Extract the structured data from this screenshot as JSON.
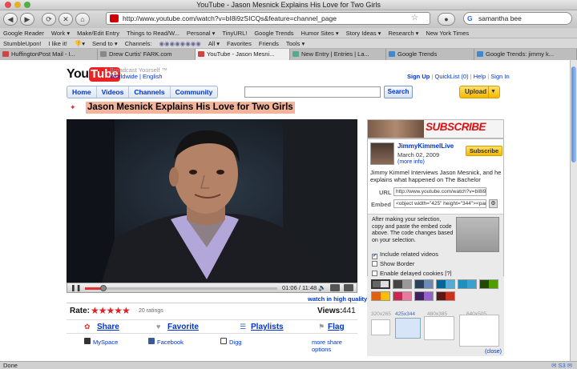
{
  "window": {
    "title": "YouTube - Jason Mesnick Explains His Love for Two Girls"
  },
  "toolbar": {
    "url": "http://www.youtube.com/watch?v=bI8i9zSICQs&feature=channel_page",
    "search_value": "samantha bee"
  },
  "bookmarks_bar1": {
    "items": [
      "Google Reader",
      "Work ▾",
      "Make/Edit Entry",
      "Things to Read/W...",
      "Personal ▾",
      "TinyURL!",
      "Google Trends",
      "Humor Sites ▾",
      "Story Ideas ▾",
      "Research ▾",
      "New York Times"
    ]
  },
  "bookmarks_bar2": {
    "items": [
      "StumbleUpon!",
      "I like it!",
      "Send to ▾",
      "Channels:",
      "All ▾",
      "Favorites",
      "Friends",
      "Tools ▾"
    ]
  },
  "tabs": [
    {
      "label": "HuffingtonPost Mail - I..."
    },
    {
      "label": "Drew Curtis' FARK.com"
    },
    {
      "label": "YouTube - Jason Mesni..."
    },
    {
      "label": "New Entry | Entries | La..."
    },
    {
      "label": "Google Trends"
    },
    {
      "label": "Google Trends: jimmy k..."
    }
  ],
  "header": {
    "logo_you": "You",
    "logo_tube": "Tube",
    "slogan": "Broadcast Yourself ™",
    "worldwide": "Worldwide | English",
    "sign_up": "Sign Up",
    "quicklist": "QuickList (0)",
    "help": "Help",
    "sign_in": "Sign In",
    "nav": [
      "Home",
      "Videos",
      "Channels",
      "Community"
    ],
    "search_button": "Search",
    "upload_button": "Upload"
  },
  "video": {
    "title": "Jason Mesnick Explains His Love for Two Girls",
    "time": "01:06 / 11:48",
    "high_quality": "watch in high quality",
    "progress_fraction": 0.094
  },
  "rating": {
    "label": "Rate:",
    "stars": "★★★★★",
    "count": "20 ratings",
    "views_label": "Views:",
    "views": "441"
  },
  "actions": {
    "share": "Share",
    "favorite": "Favorite",
    "playlists": "Playlists",
    "flag": "Flag"
  },
  "share_links": {
    "myspace": "MySpace",
    "facebook": "Facebook",
    "digg": "Digg",
    "more": "more share options"
  },
  "sidebar": {
    "subscribe_banner": "SUBSCRIBE",
    "channel_name": "JimmyKimmelLive",
    "date": "March 02, 2009",
    "more_info": "(more info)",
    "subscribe_button": "Subscribe",
    "description": "Jimmy Kimmel Interviews Jason Mesnick, and he explains what happened on The Bachelor",
    "url_label": "URL",
    "url_value": "http://www.youtube.com/watch?v=bI8i9zSICQ",
    "embed_label": "Embed",
    "embed_value": "<object width=\"425\" height=\"344\"><param na",
    "embed_help": "After making your selection, copy and paste the embed code above. The code changes based on your selection.",
    "include_related": "Include related videos",
    "show_border": "Show Border",
    "delayed_cookies": "Enable delayed cookies [?]",
    "sizes": [
      "320x265",
      "425x344",
      "480x385",
      "640x505"
    ],
    "close": "(close)"
  },
  "status": {
    "text": "Done"
  },
  "colors": {
    "youtube_red": "#e22222",
    "title_highlight": "#f2b49a",
    "link_blue": "#0033cc"
  }
}
